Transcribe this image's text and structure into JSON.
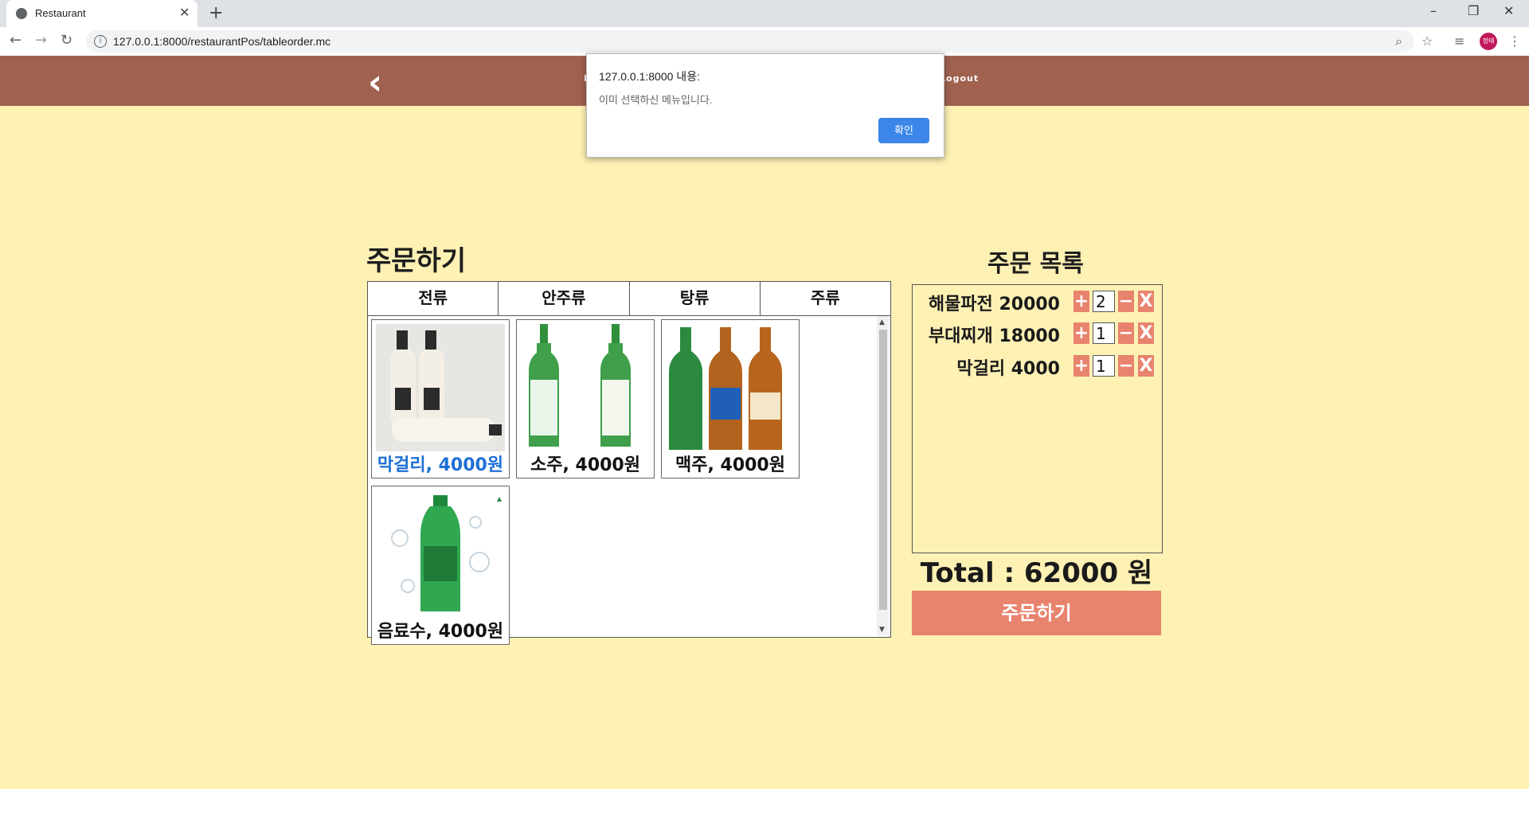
{
  "browser": {
    "tab_title": "Restaurant",
    "tab_close": "✕",
    "new_tab": "+",
    "url": "127.0.0.1:8000/restaurantPos/tableorder.mc",
    "avatar_text": "정태",
    "window_controls": [
      "–",
      "❐",
      "✕"
    ]
  },
  "header": {
    "back_icon": "‹",
    "logout_label": "Logout",
    "mid_label": "H"
  },
  "main": {
    "title": "주문하기",
    "tabs": [
      "전류",
      "안주류",
      "탕류",
      "주류"
    ],
    "menu_items": [
      {
        "label": "막걸리, 4000원",
        "active": true,
        "image": "makgeolli-bottles"
      },
      {
        "label": "소주, 4000원",
        "active": false,
        "image": "soju-bottles"
      },
      {
        "label": "맥주, 4000원",
        "active": false,
        "image": "beer-bottles"
      },
      {
        "label": "음료수, 4000원",
        "active": false,
        "image": "cider-bottle"
      }
    ]
  },
  "order_list": {
    "title": "주문 목록",
    "items": [
      {
        "name": "해물파전 20000",
        "qty": "2"
      },
      {
        "name": "부대찌개 18000",
        "qty": "1"
      },
      {
        "name": "막걸리 4000",
        "qty": "1"
      }
    ],
    "plus": "+",
    "minus": "−",
    "remove": "X",
    "total": "Total : 62000 원",
    "order_button": "주문하기"
  },
  "dialog": {
    "title": "127.0.0.1:8000 내용:",
    "message": "이미 선택하신 메뉴입니다.",
    "ok_label": "확인"
  },
  "colors": {
    "header": "#a0614f",
    "background": "#fef1b4",
    "accent": "#e8836e",
    "active_label": "#1d6fd6",
    "dialog_button": "#3b86e8"
  }
}
